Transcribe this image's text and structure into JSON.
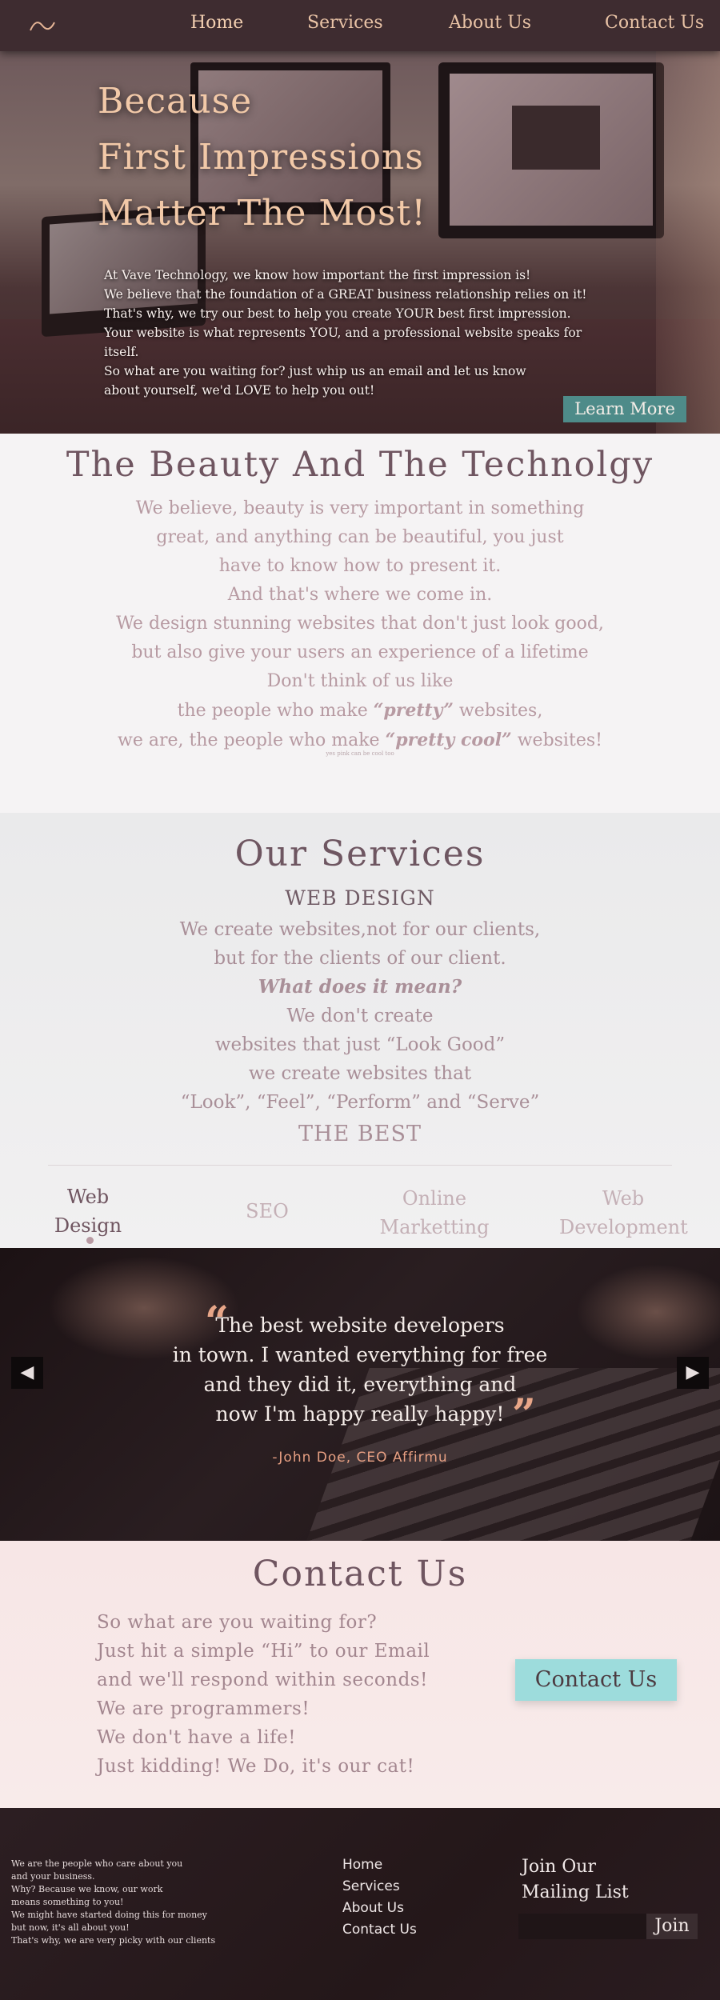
{
  "nav": {
    "logo": "wave-logo-icon",
    "items": [
      "Home",
      "Services",
      "About Us",
      "Contact Us"
    ],
    "active": "Home"
  },
  "hero": {
    "title_lines": [
      "Because",
      "First Impressions",
      "Matter The Most!"
    ],
    "text_lines": [
      "At Vave Technology, we know how important the first impression is!",
      "We believe that the foundation of a GREAT business relationship relies on it!",
      "That's why, we try our best to help you create YOUR best first impression.",
      "Your website is what represents YOU, and a professional website speaks for itself.",
      "So what are you waiting for? just whip us an email and let us know about yourself, we'd LOVE to help you out!"
    ],
    "button": "Learn More"
  },
  "beauty": {
    "title": "The Beauty And The Technolgy",
    "lines": [
      "We believe, beauty is very important in something",
      "great, and anything can be beautiful, you just",
      "have to know how to present it.",
      "And that's where we come in.",
      "We design stunning websites that don't just look good,",
      "but also give your users an experience of a lifetime",
      "Don't think of us like"
    ],
    "pretty_line": {
      "before": "the people who make ",
      "em": "“pretty”",
      "after": " websites,"
    },
    "cool_line": {
      "before": "we are, the people who make ",
      "em": "“pretty cool”",
      "after": " websites!"
    },
    "small_note": "yes pink can be cool too"
  },
  "services": {
    "title": "Our Services",
    "subtitle": "WEB DESIGN",
    "lines": [
      "We create websites,not for our clients,",
      "but for the clients of our client."
    ],
    "question": "What does it mean?",
    "lines2": [
      "We don't create",
      "websites that just “Look Good”",
      "we create websites that",
      "“Look”, “Feel”, “Perform” and “Serve”"
    ],
    "best": "THE BEST",
    "tabs": [
      {
        "line1": "Web",
        "line2": "Design"
      },
      {
        "line1": "SEO",
        "line2": ""
      },
      {
        "line1": "Online",
        "line2": "Marketting"
      },
      {
        "line1": "Web",
        "line2": "Development"
      }
    ],
    "active_tab": "Web Design"
  },
  "testimonial": {
    "quote_lines": [
      "The best website developers",
      "in town. I wanted everything for free",
      "and they did it, everything and",
      "now I'm happy really happy!"
    ],
    "open_mark": "“",
    "close_mark": "”",
    "author": "-John Doe, CEO Affirmu",
    "prev": "◀",
    "next": "▶"
  },
  "contact": {
    "title": "Contact Us",
    "lines": [
      "So what are you waiting for?",
      "Just hit a simple “Hi” to our Email",
      "and we'll respond within seconds!",
      "We are programmers!",
      "We don't have a life!",
      "Just kidding! We Do, it's our cat!"
    ],
    "button": "Contact Us"
  },
  "footer": {
    "about_lines": [
      "We are the people who care about you",
      "and your business.",
      "Why? Because we know, our work",
      "means something to you!",
      "We might have started doing this for money",
      "but now, it's all about you!",
      "That's why, we are very picky with our clients"
    ],
    "links": [
      "Home",
      "Services",
      "About Us",
      "Contact Us"
    ],
    "join_title_lines": [
      "Join Our",
      "Mailing List"
    ],
    "email_value": "",
    "join_button": "Join"
  },
  "colors": {
    "nav_bg": "#3e2c30",
    "accent_peach": "#f2c9a8",
    "teal_button": "#4e8b89",
    "contact_button": "#9ddcdc",
    "heading_mauve": "#6f5560",
    "body_pink": "#b79aa2"
  }
}
